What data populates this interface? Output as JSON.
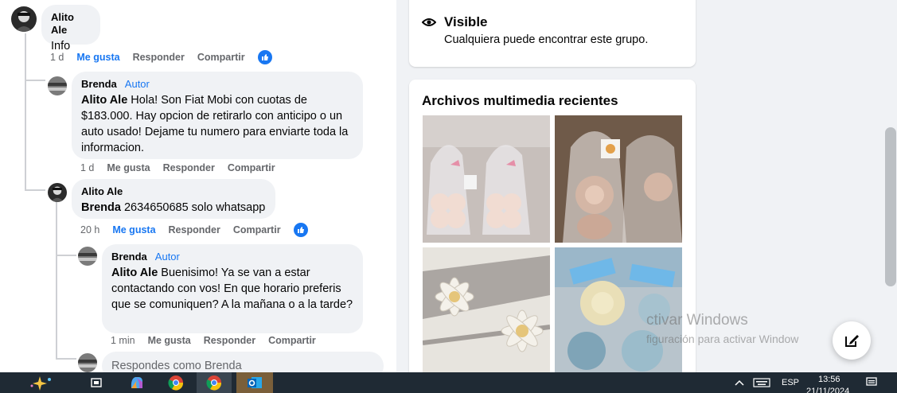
{
  "comments": [
    {
      "author": "Alito Ale",
      "badge": "",
      "mention": "",
      "text": "Info",
      "time": "1 d",
      "like": "Me gusta",
      "reply": "Responder",
      "share": "Compartir",
      "liked": true
    },
    {
      "author": "Brenda",
      "badge": "Autor",
      "mention": "Alito Ale",
      "text": " Hola! Son Fiat Mobi con cuotas de $183.000. Hay opcion de retirarlo con anticipo o un auto usado! Dejame tu numero para enviarte toda la informacion.",
      "time": "1 d",
      "like": "Me gusta",
      "reply": "Responder",
      "share": "Compartir",
      "liked": false
    },
    {
      "author": "Alito Ale",
      "badge": "",
      "mention": "Brenda",
      "text": " 2634650685 solo whatsapp",
      "time": "20 h",
      "like": "Me gusta",
      "reply": "Responder",
      "share": "Compartir",
      "liked": true
    },
    {
      "author": "Brenda",
      "badge": "Autor",
      "mention": "Alito Ale",
      "text": " Buenisimo! Ya se van a estar contactando con vos! En que horario preferis que se comuniquen? A la mañana o a la tarde?",
      "time": "1 min",
      "like": "Me gusta",
      "reply": "Responder",
      "share": "Compartir",
      "liked": false
    }
  ],
  "reply_box": {
    "placeholder": "Respondes como Brenda"
  },
  "sidebar": {
    "visibility": {
      "title": "Visible",
      "description": "Cualquiera puede encontrar este grupo."
    },
    "media": {
      "title": "Archivos multimedia recientes"
    }
  },
  "watermark": {
    "line1": "ctivar Windows",
    "line2": "figuración para activar Window"
  },
  "taskbar": {
    "language": "ESP",
    "time": "13:56",
    "date": "21/11/2024"
  },
  "colors": {
    "accent": "#1877f2",
    "bubble": "#f0f2f5",
    "secondary_text": "#65676b"
  }
}
